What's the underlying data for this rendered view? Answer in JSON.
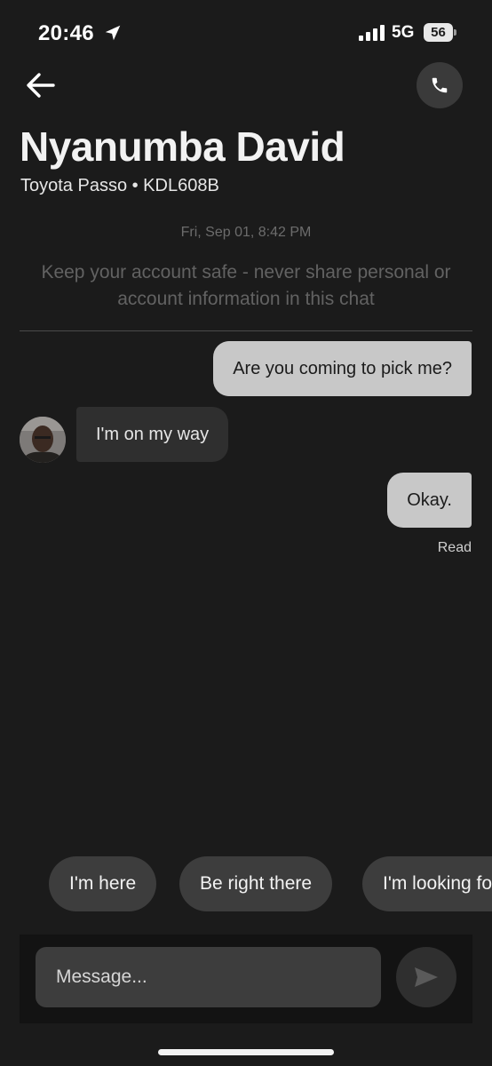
{
  "status_bar": {
    "time": "20:46",
    "network": "5G",
    "battery": "56",
    "icons": [
      "location-arrow-icon",
      "signal-icon",
      "battery-icon"
    ]
  },
  "header": {
    "back_icon": "arrow-left-icon",
    "call_icon": "phone-icon",
    "contact_name": "Nyanumba David",
    "vehicle": "Toyota Passo • KDL608B"
  },
  "chat": {
    "timestamp": "Fri, Sep 01, 8:42 PM",
    "safety_notice": "Keep your account safe - never share personal or account information in this chat",
    "messages": [
      {
        "direction": "outgoing",
        "text": "Are you coming to pick me?"
      },
      {
        "direction": "incoming",
        "text": "I'm on my way"
      },
      {
        "direction": "outgoing",
        "text": "Okay."
      }
    ],
    "read_receipt": "Read"
  },
  "quick_replies": [
    "I'm here",
    "Be right there",
    "I'm looking for you"
  ],
  "composer": {
    "placeholder": "Message...",
    "send_icon": "send-icon"
  },
  "colors": {
    "background": "#1b1b1b",
    "outgoing_bubble": "#c8c8c8",
    "incoming_bubble": "#2f2f2f",
    "chip": "#3d3d3d"
  }
}
